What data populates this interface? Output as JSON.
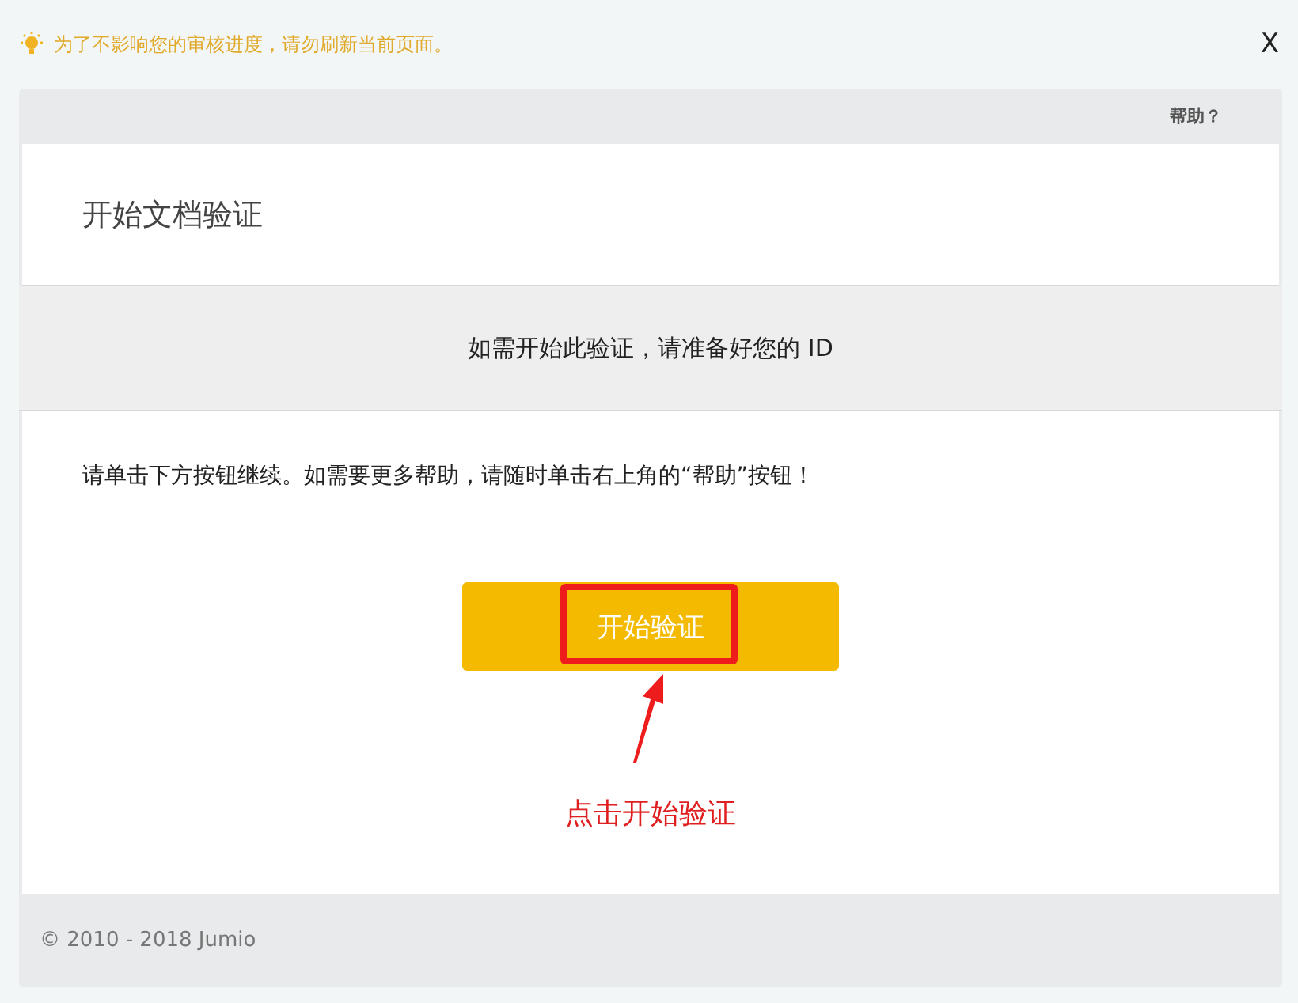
{
  "notice": {
    "text": "为了不影响您的审核进度，请勿刷新当前页面。",
    "close": "X"
  },
  "panel": {
    "help": "帮助？",
    "title": "开始文档验证",
    "banner": "如需开始此验证，请准备好您的 ID",
    "instruction": "请单击下方按钮继续。如需要更多帮助，请随时单击右上角的“帮助”按钮！",
    "start_button": "开始验证",
    "footer": "© 2010 - 2018 Jumio"
  },
  "annotation": {
    "caption": "点击开始验证"
  }
}
